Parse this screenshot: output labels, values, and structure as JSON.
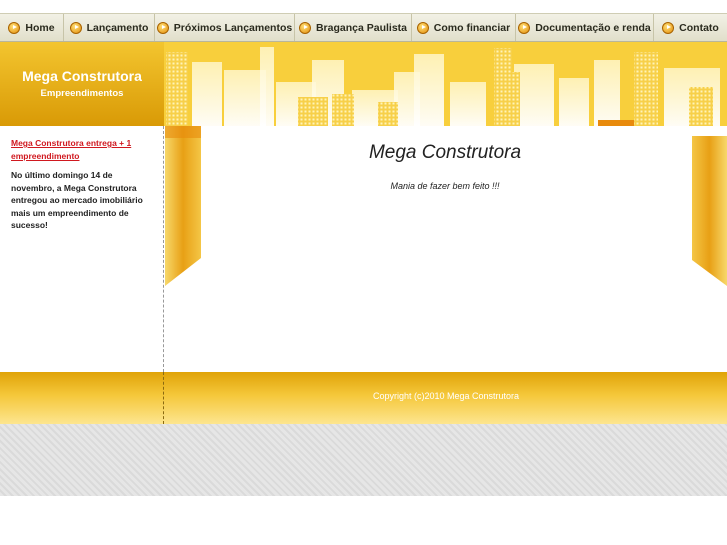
{
  "nav": {
    "items": [
      {
        "label": "Home"
      },
      {
        "label": "Lançamento"
      },
      {
        "label": "Próximos Lançamentos"
      },
      {
        "label": "Bragança Paulista"
      },
      {
        "label": "Como financiar"
      },
      {
        "label": "Documentação e renda"
      },
      {
        "label": "Contato"
      }
    ]
  },
  "header": {
    "logo_title": "Mega Construtora",
    "logo_subtitle": "Empreendimentos"
  },
  "sidebar": {
    "news_title": "Mega Construtora entrega + 1 empreendimento",
    "news_body": "No último domingo 14 de novembro, a Mega Construtora entregou ao mercado imobiliário mais um empreendimento de sucesso!"
  },
  "main": {
    "title": "Mega Construtora",
    "subtitle": "Mania de fazer bem feito !!!"
  },
  "footer": {
    "copyright": "Copyright (c)2010 Mega Construtora"
  },
  "colors": {
    "accent": "#f6c627",
    "link_red": "#d0181f",
    "ribbon_orange": "#e88a0c"
  }
}
